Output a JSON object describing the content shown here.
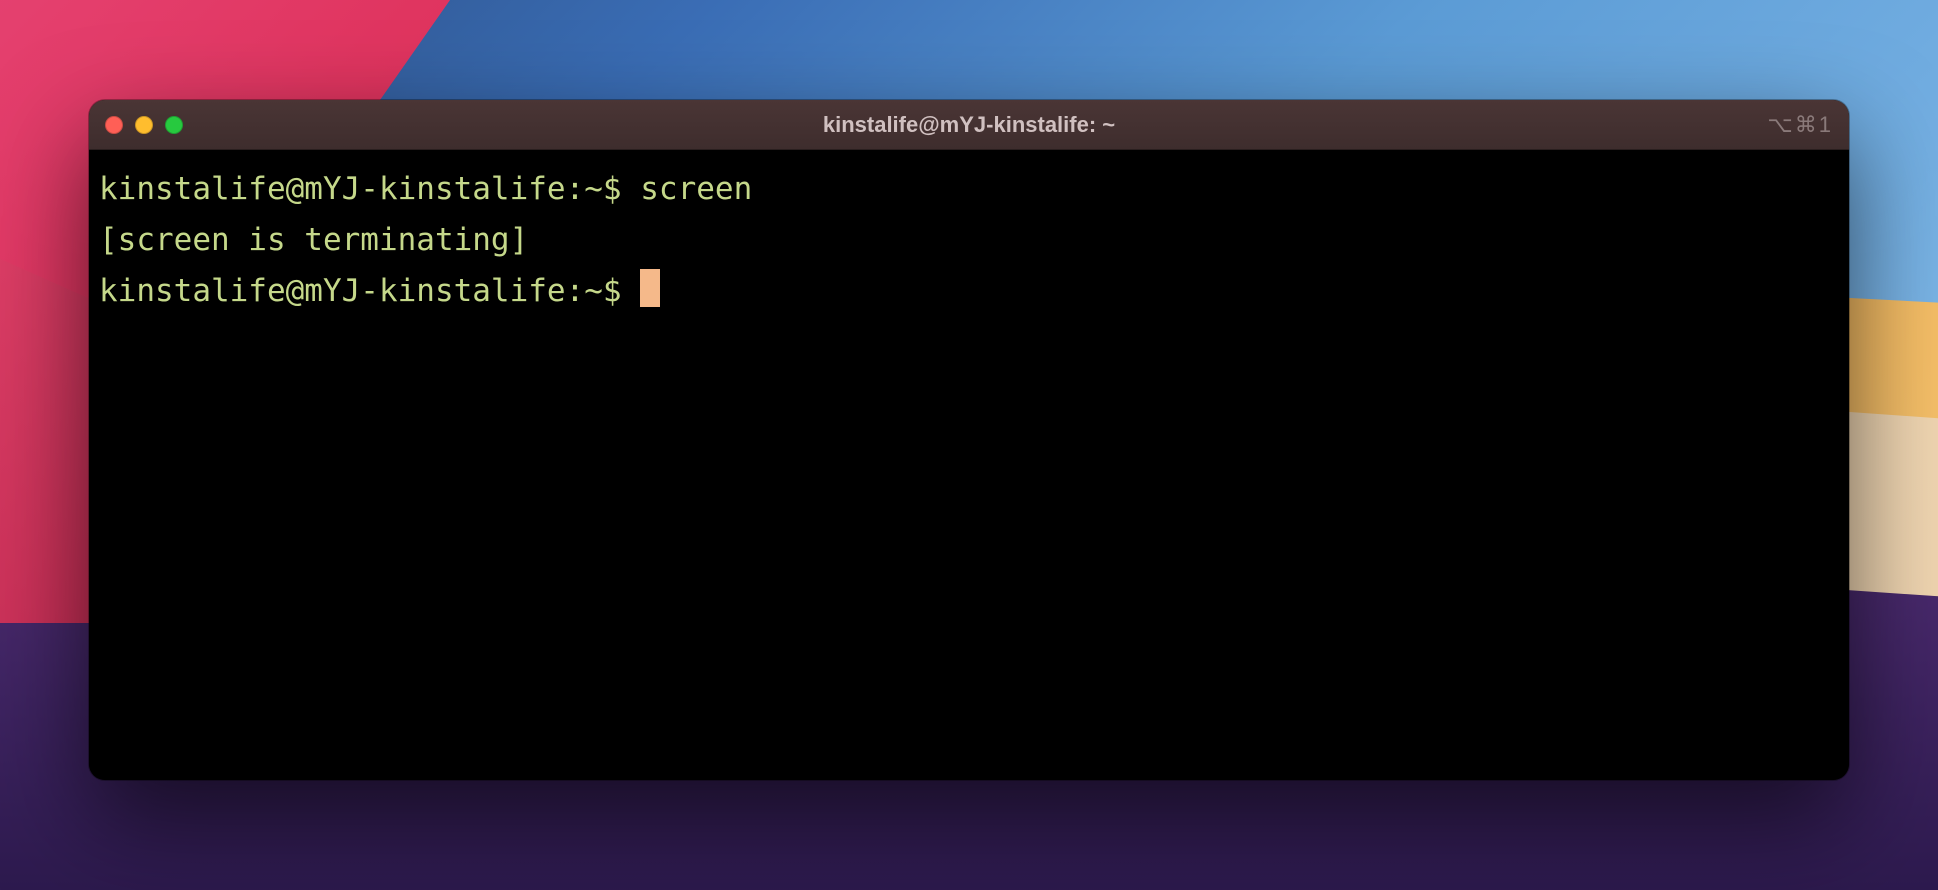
{
  "window": {
    "title": "kinstalife@mYJ-kinstalife: ~",
    "shortcut": "⌥⌘1"
  },
  "terminal": {
    "lines": [
      {
        "prompt": "kinstalife@mYJ-kinstalife:~$ ",
        "command": "screen"
      },
      {
        "output": "[screen is terminating]"
      },
      {
        "prompt": "kinstalife@mYJ-kinstalife:~$ ",
        "cursor": true
      }
    ]
  },
  "colors": {
    "traffic_close": "#ff5f56",
    "traffic_min": "#ffbd2e",
    "traffic_zoom": "#27c93f",
    "term_text": "#c5d88a",
    "term_cursor": "#f5b98a"
  }
}
